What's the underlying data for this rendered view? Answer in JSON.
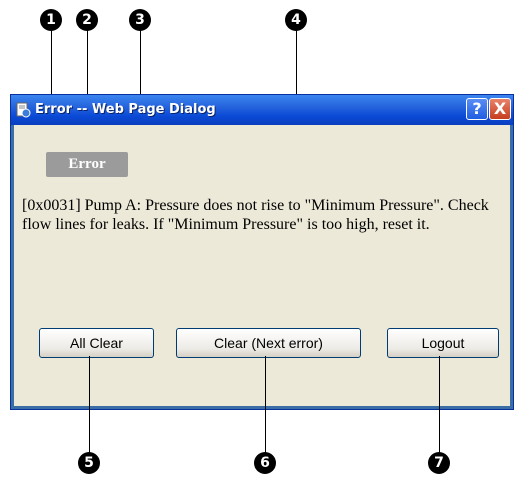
{
  "callouts": {
    "top": [
      "1",
      "2",
      "3",
      "4"
    ],
    "bottom": [
      "5",
      "6",
      "7"
    ]
  },
  "window": {
    "title": "Error -- Web Page Dialog",
    "help_label": "?",
    "close_label": "X"
  },
  "dialog": {
    "badge": "Error",
    "message": "[0x0031] Pump A: Pressure does not rise to \"Minimum Pressure\". Check flow lines for leaks. If \"Minimum Pressure\" is too high, reset it."
  },
  "buttons": {
    "all_clear": "All Clear",
    "clear_next": "Clear (Next error)",
    "logout": "Logout"
  },
  "colors": {
    "titlebar": "#0a4ad6",
    "client": "#ece9d8",
    "badge": "#9b9b9b"
  }
}
